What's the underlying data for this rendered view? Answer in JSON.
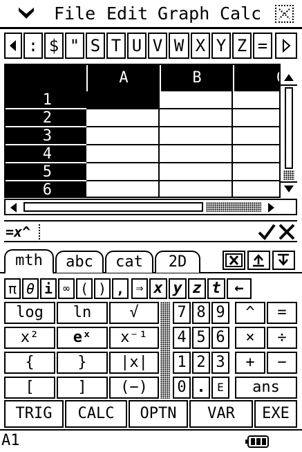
{
  "menubar": {
    "items": [
      "File",
      "Edit",
      "Graph",
      "Calc"
    ]
  },
  "symbols": [
    ":",
    "$",
    "\"",
    "S",
    "T",
    "U",
    "V",
    "W",
    "X",
    "Y",
    "Z",
    "="
  ],
  "sheet": {
    "columns": [
      "A",
      "B",
      "C"
    ],
    "rows": [
      "1",
      "2",
      "3",
      "4",
      "5",
      "6"
    ]
  },
  "editline": {
    "value": "=x^"
  },
  "kb_tabs": [
    "mth",
    "abc",
    "cat",
    "2D"
  ],
  "keys": {
    "row0": [
      "π",
      "θ",
      "i",
      "∞",
      "(",
      ")",
      ",",
      "⇒",
      "x",
      "y",
      "z",
      "t",
      "←"
    ],
    "left": [
      [
        "log",
        "ln",
        "√"
      ],
      [
        "x²",
        "eˣ",
        "x⁻¹"
      ],
      [
        "{",
        "}",
        "|x|"
      ],
      [
        "[",
        "]",
        "(−)"
      ]
    ],
    "right": [
      [
        "7",
        "8",
        "9",
        "^",
        "="
      ],
      [
        "4",
        "5",
        "6",
        "×",
        "÷"
      ],
      [
        "1",
        "2",
        "3",
        "+",
        "−"
      ],
      [
        "0",
        ".",
        "E",
        "ans"
      ]
    ]
  },
  "funcbar": [
    "TRIG",
    "CALC",
    "OPTN",
    "VAR",
    "EXE"
  ],
  "status": {
    "cell": "A1"
  }
}
